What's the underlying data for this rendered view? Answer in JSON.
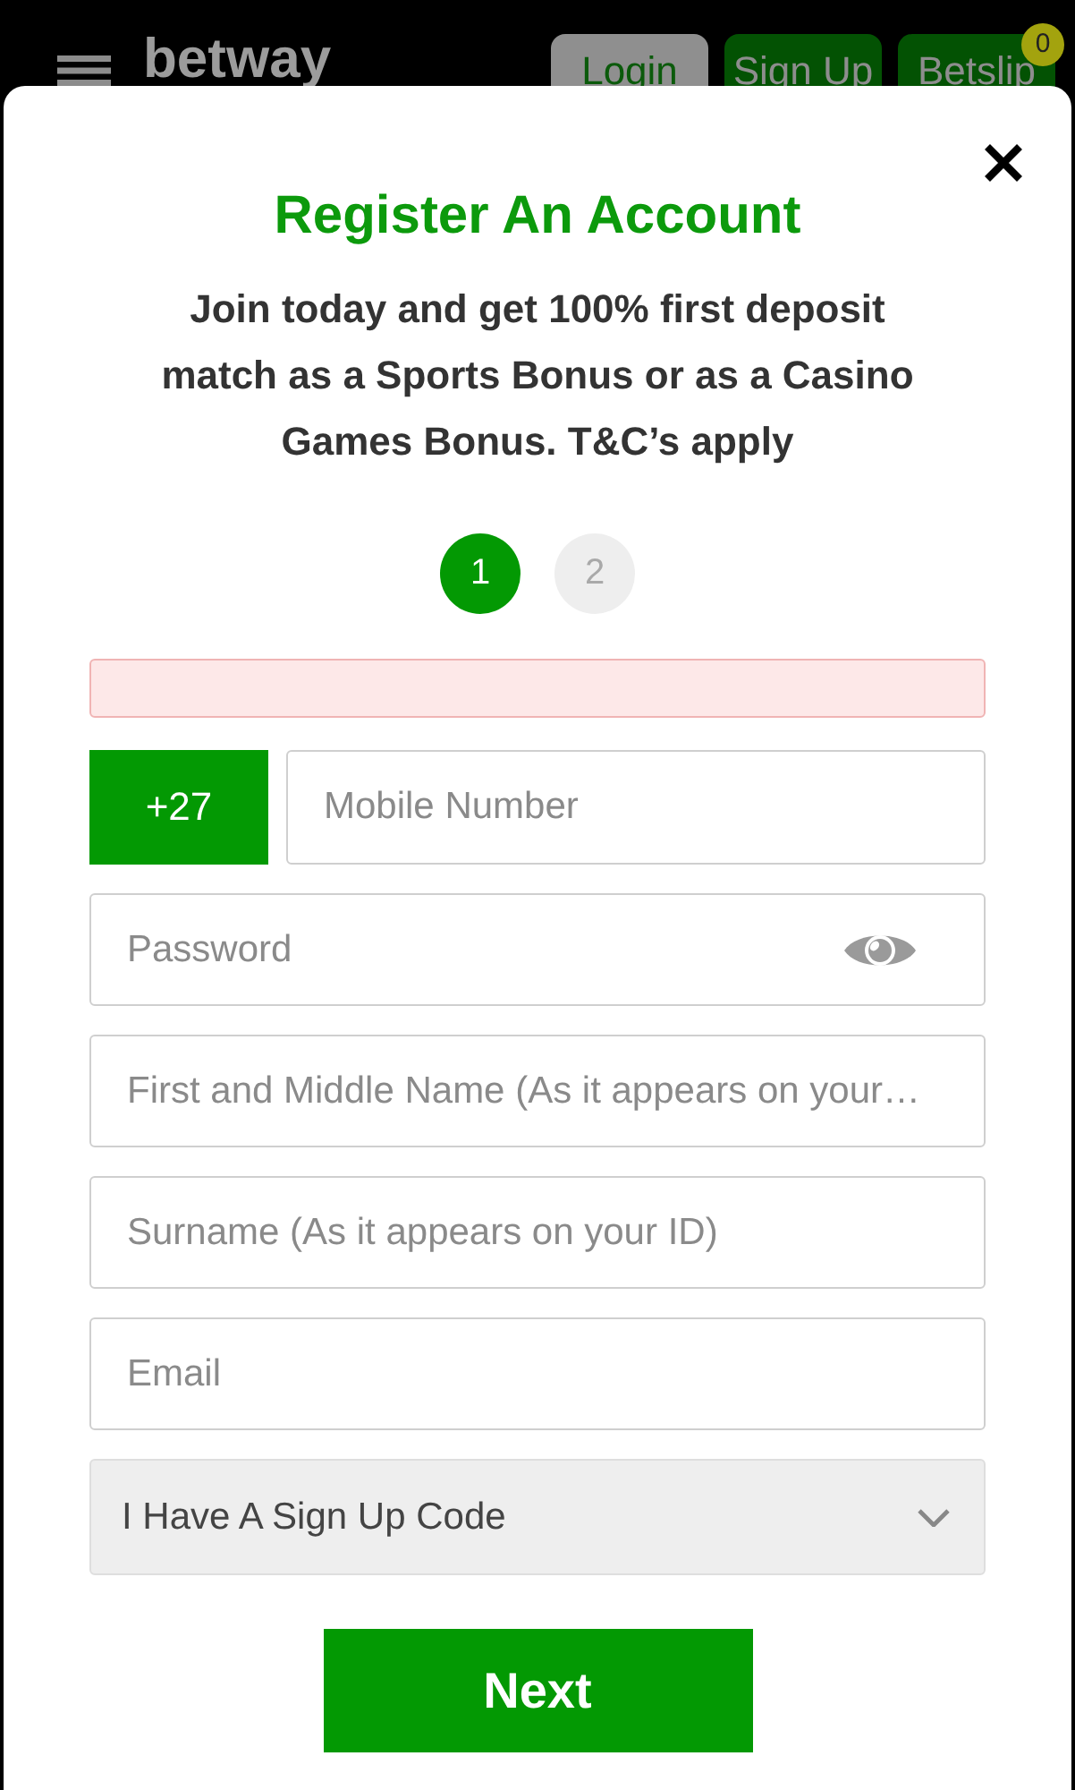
{
  "header": {
    "logo": "betway",
    "buttons": [
      {
        "label": "Login",
        "kind": "login"
      },
      {
        "label": "Sign Up",
        "kind": "signup"
      },
      {
        "label": "Betslip",
        "kind": "betslip",
        "badge": "0"
      }
    ]
  },
  "modal": {
    "title": "Register An Account",
    "intro": "Join today and get 100% first deposit match as a Sports Bonus or as a Casino Games Bonus. T&C’s apply",
    "steps": [
      {
        "label": "1",
        "selected": true
      },
      {
        "label": "2",
        "selected": false
      }
    ],
    "error_banner": {
      "shown": true
    },
    "fields": [
      {
        "kind": "phone",
        "prefix": "+27",
        "placeholder": "Mobile Number"
      },
      {
        "kind": "password",
        "placeholder": "Password"
      },
      {
        "kind": "text",
        "placeholder": "First and Middle Name (As it appears on your…"
      },
      {
        "kind": "text",
        "placeholder": "Surname (As it appears on your ID)"
      },
      {
        "kind": "text",
        "placeholder": "Email"
      },
      {
        "kind": "select",
        "value": "I Have A Sign Up Code"
      }
    ],
    "submit": "Next"
  }
}
